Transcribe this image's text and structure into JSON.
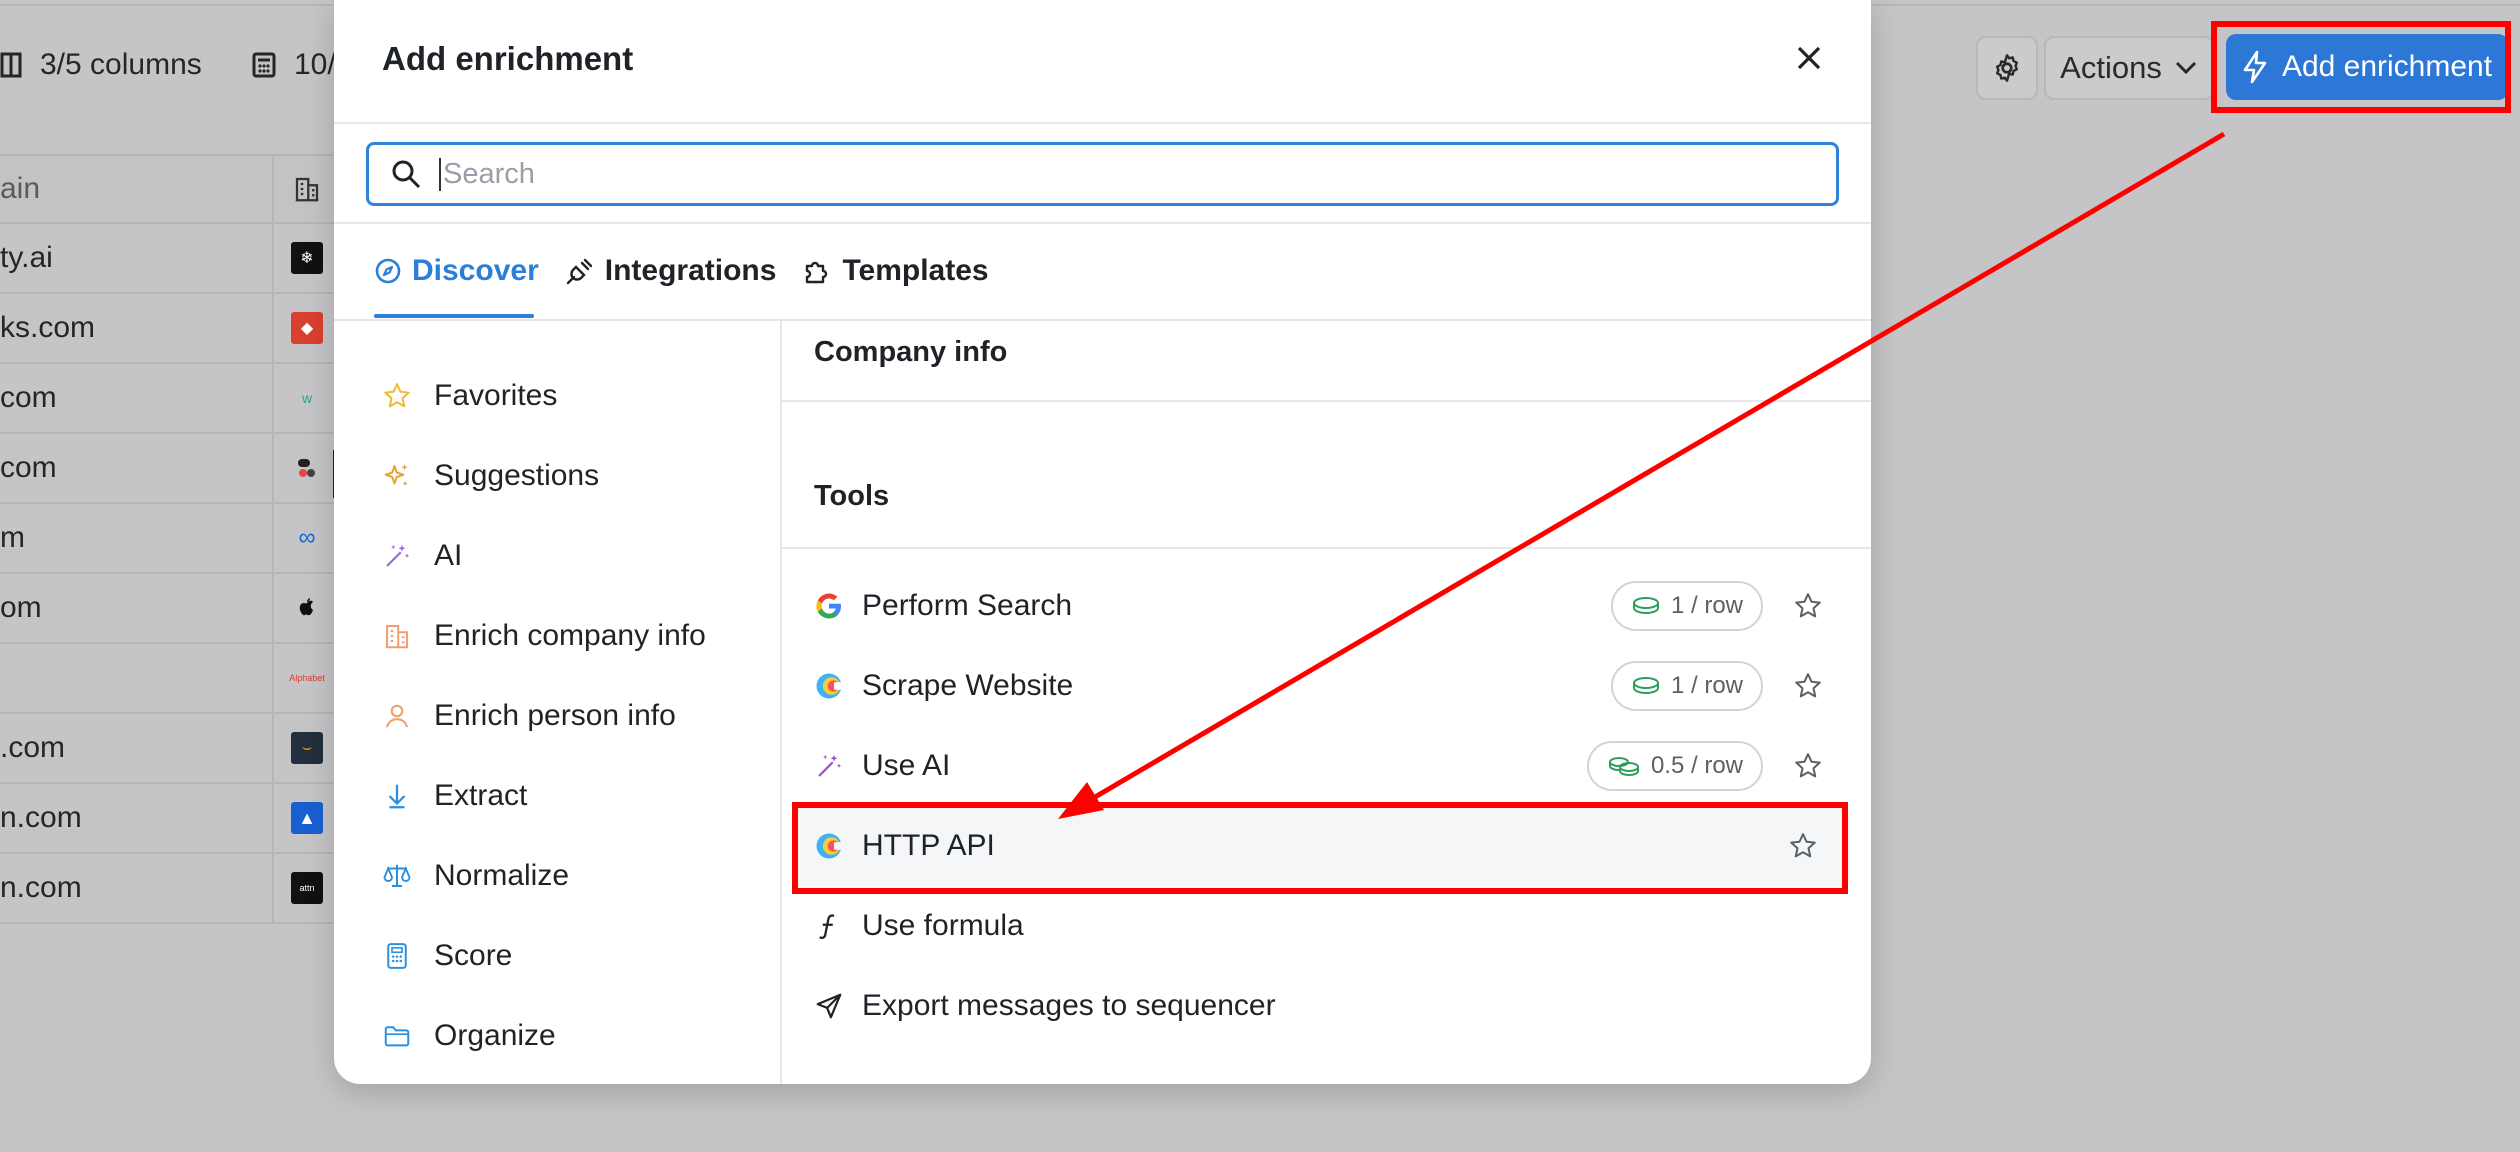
{
  "background": {
    "toolbar": {
      "columns_label": "3/5 columns",
      "rows_label": "10/",
      "actions_label": "Actions",
      "add_enrichment_label": "Add enrichment"
    },
    "table": {
      "header": "ain",
      "rows": [
        "ty.ai",
        "ks.com",
        "com",
        "com",
        "m",
        "om",
        "",
        ".com",
        "n.com",
        "n.com"
      ],
      "row_logo_texts": [
        "",
        "",
        "",
        "",
        "",
        "",
        "Alphabet",
        "",
        "",
        "attn"
      ]
    }
  },
  "modal": {
    "title": "Add enrichment",
    "search": {
      "placeholder": "Search",
      "value": ""
    },
    "tabs": [
      {
        "label": "Discover",
        "active": true
      },
      {
        "label": "Integrations",
        "active": false
      },
      {
        "label": "Templates",
        "active": false
      }
    ],
    "nav": [
      {
        "label": "Favorites",
        "icon": "star-icon"
      },
      {
        "label": "Suggestions",
        "icon": "sparkles-icon"
      },
      {
        "label": "AI",
        "icon": "magic-wand-icon"
      },
      {
        "label": "Enrich company info",
        "icon": "building-icon"
      },
      {
        "label": "Enrich person info",
        "icon": "person-icon"
      },
      {
        "label": "Extract",
        "icon": "arrow-down-icon"
      },
      {
        "label": "Normalize",
        "icon": "scale-icon"
      },
      {
        "label": "Score",
        "icon": "calculator-icon"
      },
      {
        "label": "Organize",
        "icon": "folder-icon"
      }
    ],
    "sections": {
      "company_info": "Company info",
      "tools": "Tools"
    },
    "tools": [
      {
        "label": "Perform Search",
        "credit": "1 / row",
        "icon": "google-icon"
      },
      {
        "label": "Scrape Website",
        "credit": "1 / row",
        "icon": "clay-icon"
      },
      {
        "label": "Use AI",
        "credit": "0.5 / row",
        "icon": "magic-wand-icon"
      },
      {
        "label": "HTTP API",
        "credit": "",
        "icon": "clay-icon"
      },
      {
        "label": "Use formula",
        "credit": "",
        "icon": "formula-icon"
      },
      {
        "label": "Export messages to sequencer",
        "credit": "",
        "icon": "send-icon"
      }
    ]
  },
  "colors": {
    "accent": "#2b7fd9",
    "annotation_red": "#ff0000",
    "button_blue": "#2d78d6"
  }
}
